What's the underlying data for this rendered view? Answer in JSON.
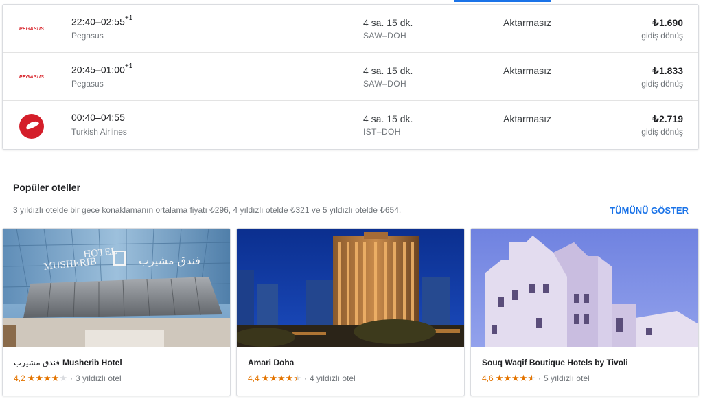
{
  "flights": [
    {
      "logo": "pegasus-logo",
      "airline_mark": "PEGASUS",
      "times": "22:40–02:55",
      "day_offset": "+1",
      "airline": "Pegasus",
      "duration": "4 sa. 15 dk.",
      "route": "SAW–DOH",
      "stops": "Aktarmasız",
      "price": "₺1.690",
      "price_note": "gidiş dönüş"
    },
    {
      "logo": "pegasus-logo",
      "airline_mark": "PEGASUS",
      "times": "20:45–01:00",
      "day_offset": "+1",
      "airline": "Pegasus",
      "duration": "4 sa. 15 dk.",
      "route": "SAW–DOH",
      "stops": "Aktarmasız",
      "price": "₺1.833",
      "price_note": "gidiş dönüş"
    },
    {
      "logo": "turkish-airlines-logo",
      "times": "00:40–04:55",
      "day_offset": "",
      "airline": "Turkish Airlines",
      "duration": "4 sa. 15 dk.",
      "route": "IST–DOH",
      "stops": "Aktarmasız",
      "price": "₺2.719",
      "price_note": "gidiş dönüş"
    }
  ],
  "hotels_section": {
    "title": "Popüler oteller",
    "description": "3 yıldızlı otelde bir gece konaklamanın ortalama fiyatı ₺296, 4 yıldızlı otelde ₺321 ve 5 yıldızlı otelde ₺654.",
    "show_all": "TÜMÜNÜ GÖSTER"
  },
  "hotels": [
    {
      "arabic_name": "فندق مشيرب",
      "name": "Musherib Hotel",
      "rating": "4,2",
      "rating_value": 4.2,
      "stars_text": "3 yıldızlı otel",
      "image_signage": {
        "line1": "HOTEL",
        "line2": "MUSHERIB",
        "arabic": "فندق مشيرب"
      }
    },
    {
      "arabic_name": "",
      "name": "Amari Doha",
      "rating": "4,4",
      "rating_value": 4.4,
      "stars_text": "4 yıldızlı otel"
    },
    {
      "arabic_name": "",
      "name": "Souq Waqif Boutique Hotels by Tivoli",
      "rating": "4,6",
      "rating_value": 4.6,
      "stars_text": "5 yıldızlı otel"
    }
  ],
  "colors": {
    "accent": "#1a73e8",
    "star": "#e37400",
    "pegasus": "#d8232a",
    "turkish": "#d41e2a"
  }
}
